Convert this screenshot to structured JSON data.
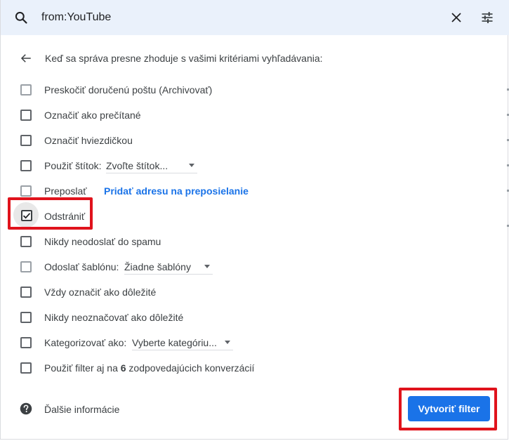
{
  "search": {
    "query": "from:YouTube"
  },
  "header": {
    "text": "Keď sa správa presne zhoduje s vašimi kritériami vyhľadávania:"
  },
  "options": {
    "skip_inbox": "Preskočiť doručenú poštu (Archivovať)",
    "mark_read": "Označiť ako prečítané",
    "star": "Označiť hviezdičkou",
    "apply_label": "Použiť štítok:",
    "label_select": "Zvoľte štítok...",
    "forward": "Preposlať",
    "forward_link": "Pridať adresu na preposielanie",
    "delete": "Odstrániť",
    "never_spam": "Nikdy neodoslať do spamu",
    "send_template": "Odoslať šablónu:",
    "template_select": "Žiadne šablóny",
    "always_important": "Vždy označiť ako dôležité",
    "never_important": "Nikdy neoznačovať ako dôležité",
    "categorize": "Kategorizovať ako:",
    "category_select": "Vyberte kategóriu...",
    "apply_prefix": "Použiť filter aj na ",
    "apply_count": "6",
    "apply_suffix": " zodpovedajúcich konverzácií"
  },
  "states": {
    "delete_checked": true
  },
  "footer": {
    "more_info": "Ďalšie informácie",
    "create_button": "Vytvoriť filter"
  },
  "icons": {
    "search": "search-icon",
    "close": "close-icon",
    "tune": "tune-icon",
    "back": "arrow-back-icon",
    "help": "help-icon",
    "check": "check-icon"
  },
  "colors": {
    "accent": "#1a73e8",
    "highlight": "#e0131c",
    "searchbar_bg": "#eaf1fb"
  }
}
